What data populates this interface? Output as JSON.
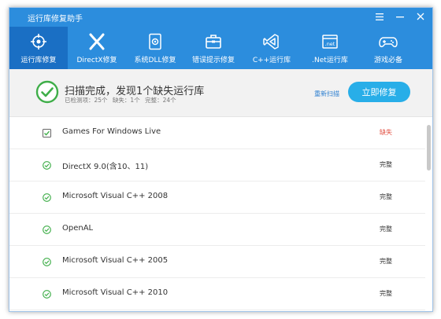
{
  "app": {
    "title": "运行库修复助手"
  },
  "tabs": [
    {
      "label": "运行库修复",
      "icon": "target-icon",
      "active": true
    },
    {
      "label": "DirectX修复",
      "icon": "directx-icon"
    },
    {
      "label": "系统DLL修复",
      "icon": "dll-gear-icon"
    },
    {
      "label": "错误提示修复",
      "icon": "toolbox-icon"
    },
    {
      "label": "C++运行库",
      "icon": "visual-studio-icon"
    },
    {
      "label": ".Net运行库",
      "icon": "dotnet-icon"
    },
    {
      "label": "游戏必备",
      "icon": "gamepad-icon"
    }
  ],
  "status": {
    "main": "扫描完成，发现1个缺失运行库",
    "detected": "已检测项：25个",
    "missing": "缺失：1个",
    "complete": "完整：24个",
    "rescan_label": "重新扫描",
    "fix_label": "立即修复"
  },
  "items": [
    {
      "name": "Games For Windows Live",
      "status": "缺失",
      "state": "missing"
    },
    {
      "name": "DirectX 9.0(含10、11)",
      "status": "完整",
      "state": "ok"
    },
    {
      "name": "Microsoft Visual C++ 2008",
      "status": "完整",
      "state": "ok"
    },
    {
      "name": "OpenAL",
      "status": "完整",
      "state": "ok"
    },
    {
      "name": "Microsoft Visual C++ 2005",
      "status": "完整",
      "state": "ok"
    },
    {
      "name": "Microsoft Visual C++ 2010",
      "status": "完整",
      "state": "ok"
    }
  ],
  "colors": {
    "header": "#2c8ddd",
    "active_tab": "#1a6fc4",
    "fix_button": "#28aee8",
    "missing": "#e0493b",
    "ok": "#3fae49"
  }
}
